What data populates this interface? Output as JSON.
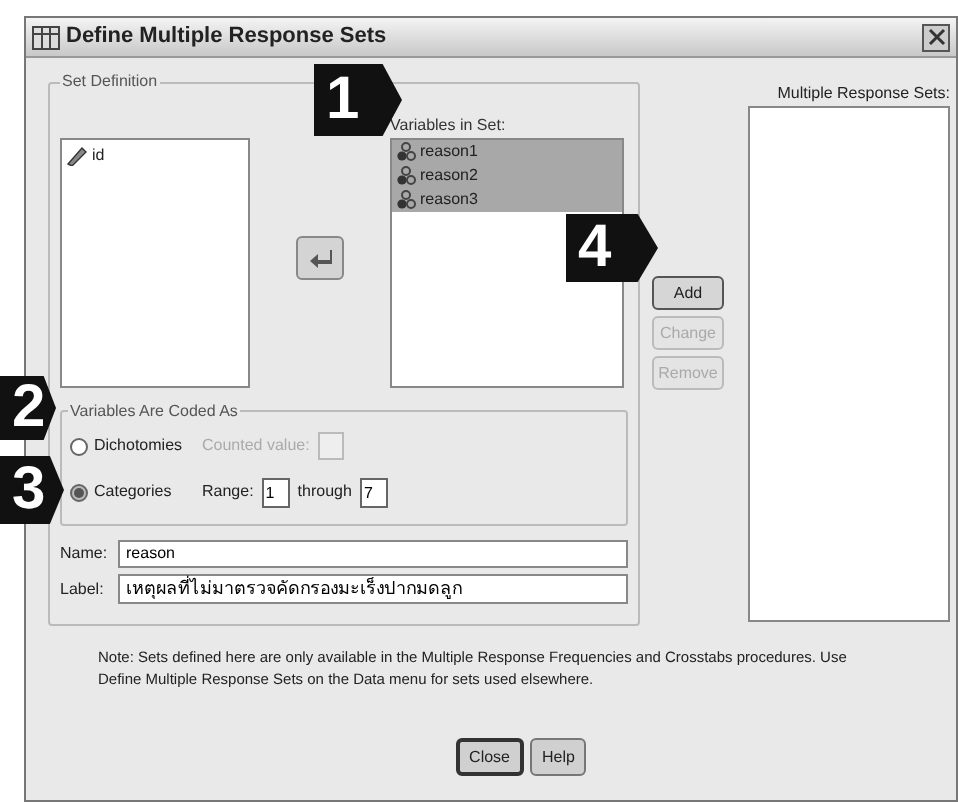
{
  "window": {
    "title": "Define Multiple Response Sets"
  },
  "set_definition": {
    "title": "Set Definition",
    "source_variables": [
      {
        "name": "id",
        "selected": false
      }
    ],
    "variables_in_set_label": "Variables in Set:",
    "variables_in_set": [
      {
        "name": "reason1",
        "selected": true
      },
      {
        "name": "reason2",
        "selected": true
      },
      {
        "name": "reason3",
        "selected": true
      }
    ],
    "coded_as": {
      "title": "Variables Are Coded As",
      "options": [
        {
          "label": "Dichotomies",
          "selected": false
        },
        {
          "label": "Categories",
          "selected": true
        }
      ],
      "counted_value": {
        "label": "Counted value:",
        "disabled": true
      },
      "range_label": "Range:",
      "range_from": "1",
      "through_label": "through",
      "range_to": "7"
    },
    "name_field": {
      "label": "Name:",
      "value": "reason"
    },
    "label_field": {
      "label": "Label:",
      "value": "เหตุผลที่ไม่มาตรวจคัดกรองมะเร็งปากมดลูก"
    }
  },
  "side_buttons": [
    {
      "label": "Add",
      "disabled": false
    },
    {
      "label": "Change",
      "disabled": true
    },
    {
      "label": "Remove",
      "disabled": true
    }
  ],
  "response_sets": {
    "label": "Multiple Response Sets:"
  },
  "note": "Note: Sets defined here are only available in the Multiple Response Frequencies and Crosstabs procedures. Use Define Multiple Response Sets on the Data menu for sets used elsewhere.",
  "buttons": [
    "Close",
    "Help"
  ],
  "callouts": [
    "1",
    "2",
    "3",
    "4"
  ]
}
